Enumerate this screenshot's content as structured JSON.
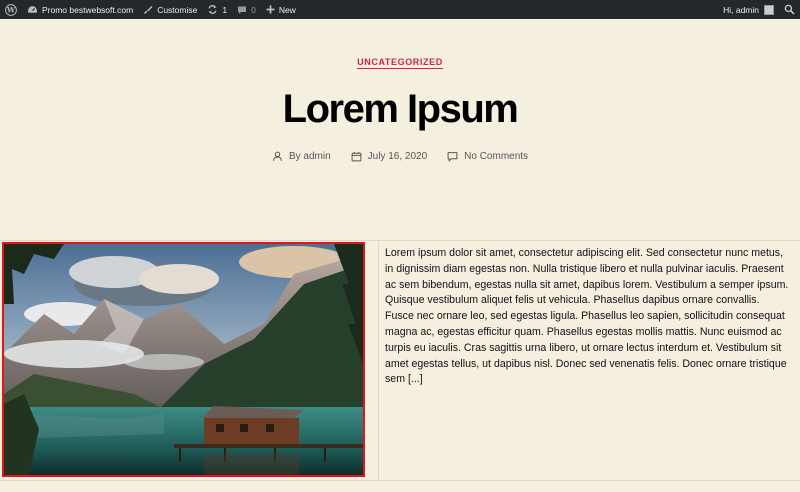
{
  "admin_bar": {
    "site_name": "Promo bestwebsoft.com",
    "customise": "Customise",
    "updates_count": "1",
    "comments_count": "0",
    "new_label": "New",
    "greeting": "Hi, admin"
  },
  "post": {
    "category": "UNCATEGORIZED",
    "title": "Lorem Ipsum",
    "author": "By admin",
    "date": "July 16, 2020",
    "comments": "No Comments",
    "excerpt": "Lorem ipsum dolor sit amet, consectetur adipiscing elit. Sed consectetur nunc metus, in dignissim diam egestas non. Nulla tristique libero et nulla pulvinar iaculis. Praesent ac sem bibendum, egestas nulla sit amet, dapibus lorem. Vestibulum a semper ipsum. Quisque vestibulum aliquet felis ut vehicula. Phasellus dapibus ornare convallis. Fusce nec ornare leo, sed egestas ligula. Phasellus leo sapien, sollicitudin consequat magna ac, egestas efficitur quam. Phasellus egestas mollis mattis. Nunc euismod ac turpis eu iaculis. Cras sagittis urna libero, ut ornare lectus interdum et. Vestibulum sit amet egestas tellus, ut dapibus nisl. Donec sed venenatis felis. Donec ornare tristique sem [...]"
  },
  "colors": {
    "background": "#f5efe0",
    "admin_bar": "#23282d",
    "accent": "#cd2653",
    "image_highlight": "#e0161b"
  }
}
